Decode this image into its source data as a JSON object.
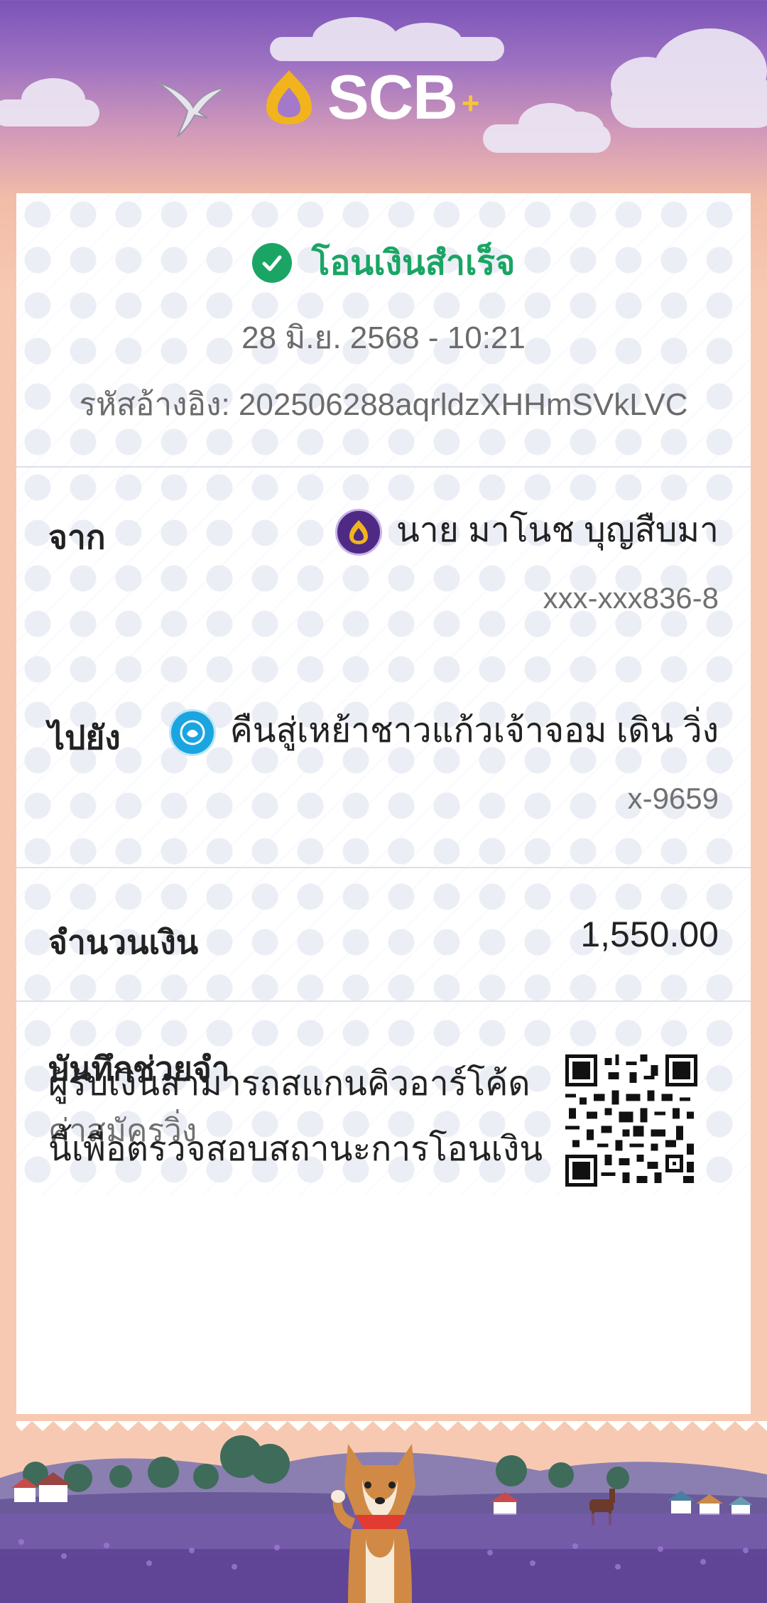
{
  "header": {
    "brand": "SCB",
    "brand_plus": "+"
  },
  "receipt": {
    "status": "โอนเงินสำเร็จ",
    "datetime": "28 มิ.ย. 2568 - 10:21",
    "reference_label": "รหัสอ้างอิง:",
    "reference_value": "202506288aqrldzXHHmSVkLVC",
    "from": {
      "label": "จาก",
      "name": "นาย มาโนช บุญสืบมา",
      "account": "xxx-xxx836-8"
    },
    "to": {
      "label": "ไปยัง",
      "name": "คืนสู่เหย้าชาวแก้วเจ้าจอม เดิน วิ่ง",
      "account": "x-9659"
    },
    "amount": {
      "label": "จำนวนเงิน",
      "value": "1,550.00"
    },
    "memo": {
      "label": "บันทึกช่วยจำ",
      "value": "ค่าสมัครวิ่ง"
    },
    "qr_note": "ผู้รับเงินสามารถสแกนคิวอาร์โค้ดนี้เพื่อตรวจสอบสถานะการโอนเงิน"
  },
  "colors": {
    "success": "#1aa564",
    "scb_purple": "#4e2a84",
    "ktb_blue": "#1ba5e0"
  }
}
